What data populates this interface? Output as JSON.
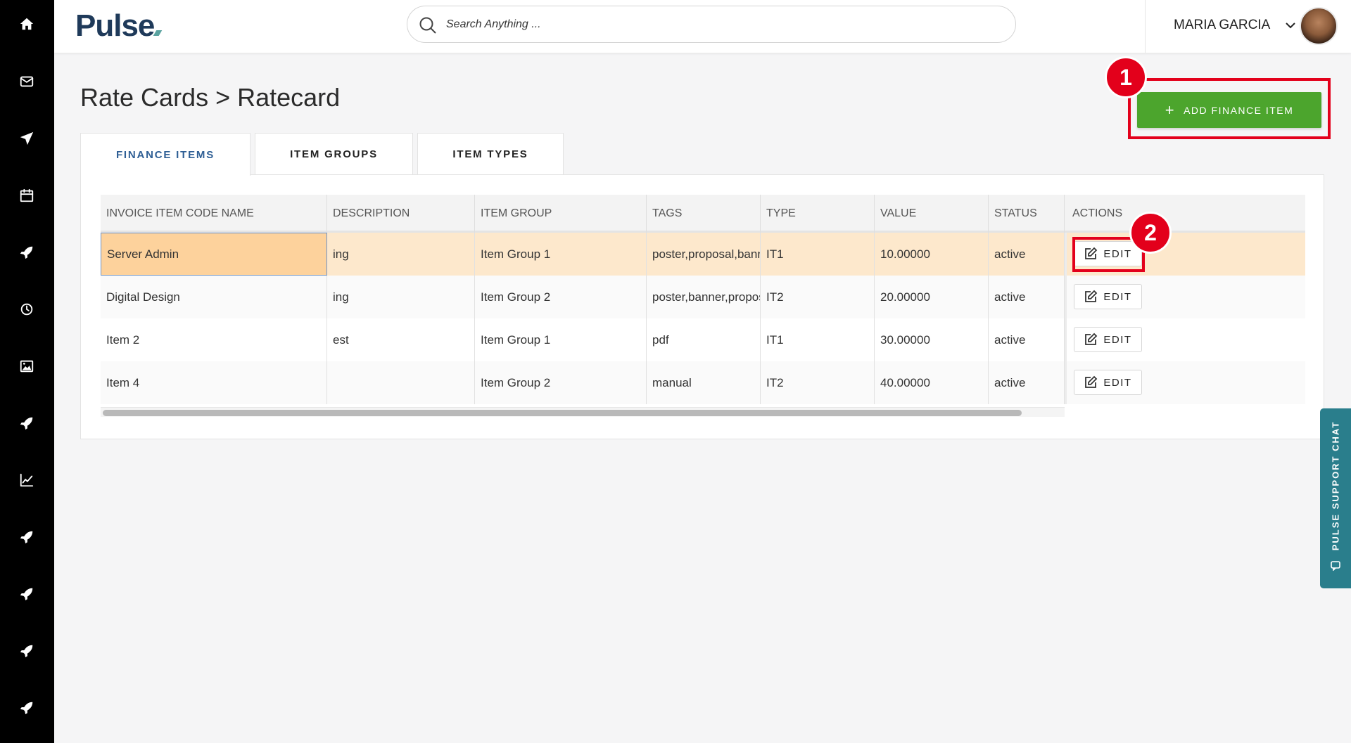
{
  "sidebar": {
    "icons": [
      "home-icon",
      "mail-icon",
      "send-icon",
      "calendar-icon",
      "rocket-icon",
      "clock-icon",
      "image-icon",
      "rocket-icon",
      "chart-icon",
      "rocket-icon",
      "rocket-icon",
      "rocket-icon",
      "rocket-icon"
    ]
  },
  "topbar": {
    "logo": "Pulse",
    "search_placeholder": "Search Anything ...",
    "user_name": "MARIA GARCIA"
  },
  "page": {
    "title": "Rate Cards > Ratecard",
    "add_button_label": "ADD FINANCE ITEM",
    "add_button_color": "#4ca52d"
  },
  "annotations": {
    "badge_1": "1",
    "badge_2": "2",
    "color": "#e3001b"
  },
  "tabs": [
    {
      "label": "FINANCE ITEMS",
      "active": true
    },
    {
      "label": "ITEM GROUPS",
      "active": false
    },
    {
      "label": "ITEM TYPES",
      "active": false
    }
  ],
  "table": {
    "columns": [
      "INVOICE ITEM CODE NAME",
      "DESCRIPTION",
      "ITEM GROUP",
      "TAGS",
      "TYPE",
      "VALUE",
      "STATUS",
      "ACTIONS"
    ],
    "rows": [
      {
        "name": "Server Admin",
        "description": "ing",
        "item_group": "Item Group 1",
        "tags": "poster,proposal,banner",
        "type": "IT1",
        "value": "10.00000",
        "status": "active",
        "action": "EDIT"
      },
      {
        "name": "Digital Design",
        "description": "ing",
        "item_group": "Item Group 2",
        "tags": "poster,banner,proposal",
        "type": "IT2",
        "value": "20.00000",
        "status": "active",
        "action": "EDIT"
      },
      {
        "name": "Item 2",
        "description": "est",
        "item_group": "Item Group 1",
        "tags": "pdf",
        "type": "IT1",
        "value": "30.00000",
        "status": "active",
        "action": "EDIT"
      },
      {
        "name": "Item 4",
        "description": "",
        "item_group": "Item Group 2",
        "tags": "manual",
        "type": "IT2",
        "value": "40.00000",
        "status": "active",
        "action": "EDIT"
      }
    ]
  },
  "support_chat": {
    "label": "PULSE SUPPORT CHAT",
    "color": "#2a7e8c"
  }
}
